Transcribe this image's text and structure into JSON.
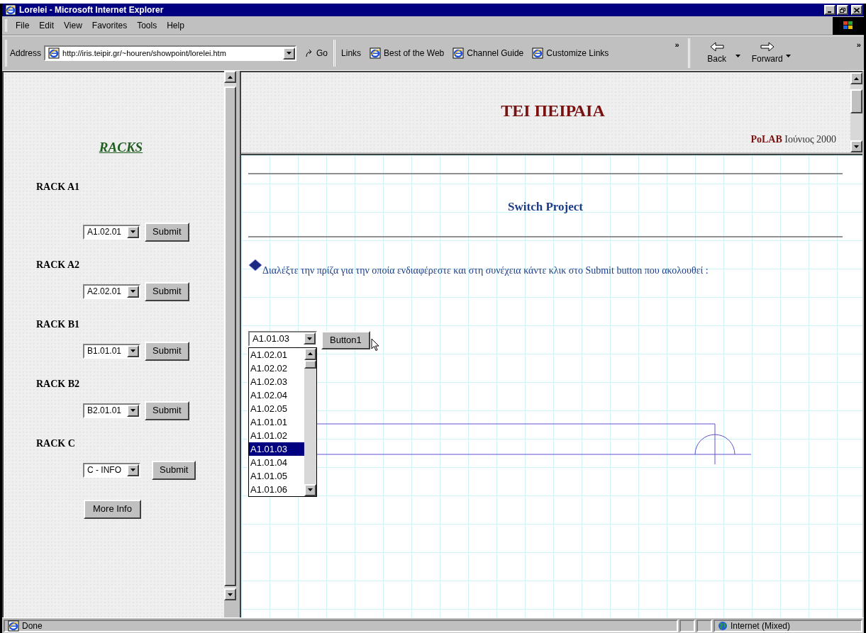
{
  "window": {
    "title": "Lorelei - Microsoft Internet Explorer"
  },
  "menu": [
    "File",
    "Edit",
    "View",
    "Favorites",
    "Tools",
    "Help"
  ],
  "address": {
    "label": "Address",
    "url": "http://iris.teipir.gr/~houren/showpoint/lorelei.htm",
    "go": "Go"
  },
  "links": {
    "label": "Links",
    "items": [
      "Best of the Web",
      "Channel Guide",
      "Customize Links"
    ],
    "more": "»"
  },
  "nav": [
    "Back",
    "Forward"
  ],
  "nav_more": "»",
  "left_frame": {
    "heading": "RACKS",
    "racks": [
      {
        "label": "RACK A1",
        "value": "A1.02.01",
        "button": "Submit"
      },
      {
        "label": "RACK A2",
        "value": "A2.02.01",
        "button": "Submit"
      },
      {
        "label": "RACK B1",
        "value": "B1.01.01",
        "button": "Submit"
      },
      {
        "label": "RACK B2",
        "value": "B2.01.01",
        "button": "Submit"
      },
      {
        "label": "RACK C",
        "value": "C - INFO",
        "button": "Submit"
      }
    ],
    "more_info": "More Info"
  },
  "top_frame": {
    "title": "ΤΕΙ ΠΕΙΡΑΙΑ",
    "credit_bold": "PoLAB",
    "credit": "Ιούνιος 2000"
  },
  "content": {
    "heading": "Switch Project",
    "instruction": "Διαλέξτε την πρίζα για την οποία ενδιαφέρεστε και στη συνέχεια κάντε κλικ στο Submit button που ακολουθεί :",
    "dropdown": {
      "value": "A1.01.03",
      "options": [
        {
          "label": "A1.02.01",
          "selected": false
        },
        {
          "label": "A1.02.02",
          "selected": false
        },
        {
          "label": "A1.02.03",
          "selected": false
        },
        {
          "label": "A1.02.04",
          "selected": false
        },
        {
          "label": "A1.02.05",
          "selected": false
        },
        {
          "label": "A1.01.01",
          "selected": false
        },
        {
          "label": "A1.01.02",
          "selected": false
        },
        {
          "label": "A1.01.03",
          "selected": true
        },
        {
          "label": "A1.01.04",
          "selected": false
        },
        {
          "label": "A1.01.05",
          "selected": false
        },
        {
          "label": "A1.01.06",
          "selected": false
        }
      ]
    },
    "button": "Button1"
  },
  "status_bar": {
    "text": "Done",
    "zone": "Internet (Mixed)"
  }
}
